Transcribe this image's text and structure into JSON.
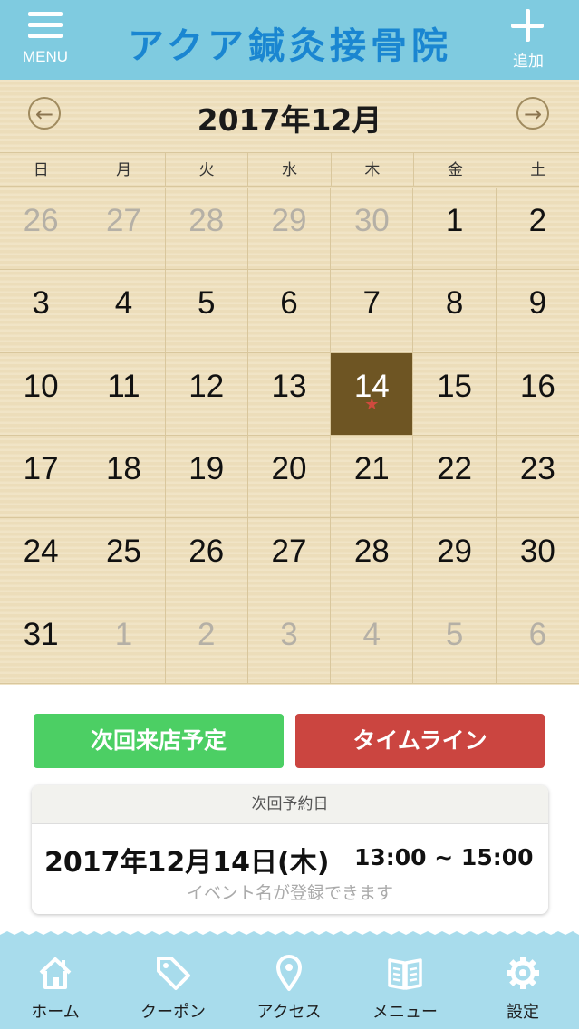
{
  "header": {
    "menu_label": "MENU",
    "title": "アクア鍼灸接骨院",
    "add_label": "追加"
  },
  "calendar": {
    "month_title": "2017年12月",
    "prev_icon": "left-arrow-circle-icon",
    "next_icon": "right-arrow-circle-icon",
    "weekdays": [
      "日",
      "月",
      "火",
      "水",
      "木",
      "金",
      "土"
    ],
    "days": [
      {
        "d": "26",
        "other": true
      },
      {
        "d": "27",
        "other": true
      },
      {
        "d": "28",
        "other": true
      },
      {
        "d": "29",
        "other": true
      },
      {
        "d": "30",
        "other": true
      },
      {
        "d": "1"
      },
      {
        "d": "2"
      },
      {
        "d": "3"
      },
      {
        "d": "4"
      },
      {
        "d": "5"
      },
      {
        "d": "6"
      },
      {
        "d": "7"
      },
      {
        "d": "8"
      },
      {
        "d": "9"
      },
      {
        "d": "10"
      },
      {
        "d": "11"
      },
      {
        "d": "12"
      },
      {
        "d": "13"
      },
      {
        "d": "14",
        "selected": true,
        "mark": "★"
      },
      {
        "d": "15"
      },
      {
        "d": "16"
      },
      {
        "d": "17"
      },
      {
        "d": "18"
      },
      {
        "d": "19"
      },
      {
        "d": "20"
      },
      {
        "d": "21"
      },
      {
        "d": "22"
      },
      {
        "d": "23"
      },
      {
        "d": "24"
      },
      {
        "d": "25"
      },
      {
        "d": "26"
      },
      {
        "d": "27"
      },
      {
        "d": "28"
      },
      {
        "d": "29"
      },
      {
        "d": "30"
      },
      {
        "d": "31"
      },
      {
        "d": "1",
        "other": true
      },
      {
        "d": "2",
        "other": true
      },
      {
        "d": "3",
        "other": true
      },
      {
        "d": "4",
        "other": true
      },
      {
        "d": "5",
        "other": true
      },
      {
        "d": "6",
        "other": true
      }
    ]
  },
  "actions": {
    "next_visit": "次回来店予定",
    "timeline": "タイムライン"
  },
  "appointment": {
    "heading": "次回予約日",
    "date": "2017年12月14日(木)",
    "time": "13:00 ~ 15:00",
    "event": "イベント名が登録できます"
  },
  "tabs": [
    {
      "label": "ホーム",
      "icon": "home-icon"
    },
    {
      "label": "クーポン",
      "icon": "tag-icon"
    },
    {
      "label": "アクセス",
      "icon": "map-pin-icon"
    },
    {
      "label": "メニュー",
      "icon": "book-icon"
    },
    {
      "label": "設定",
      "icon": "gear-icon"
    }
  ],
  "colors": {
    "header_bg": "#7fcbe0",
    "title": "#1a86d1",
    "selected_day": "#6e5523",
    "next_visit_btn": "#4ccf64",
    "timeline_btn": "#cb4540",
    "tabbar_bg": "#a8dcec"
  }
}
